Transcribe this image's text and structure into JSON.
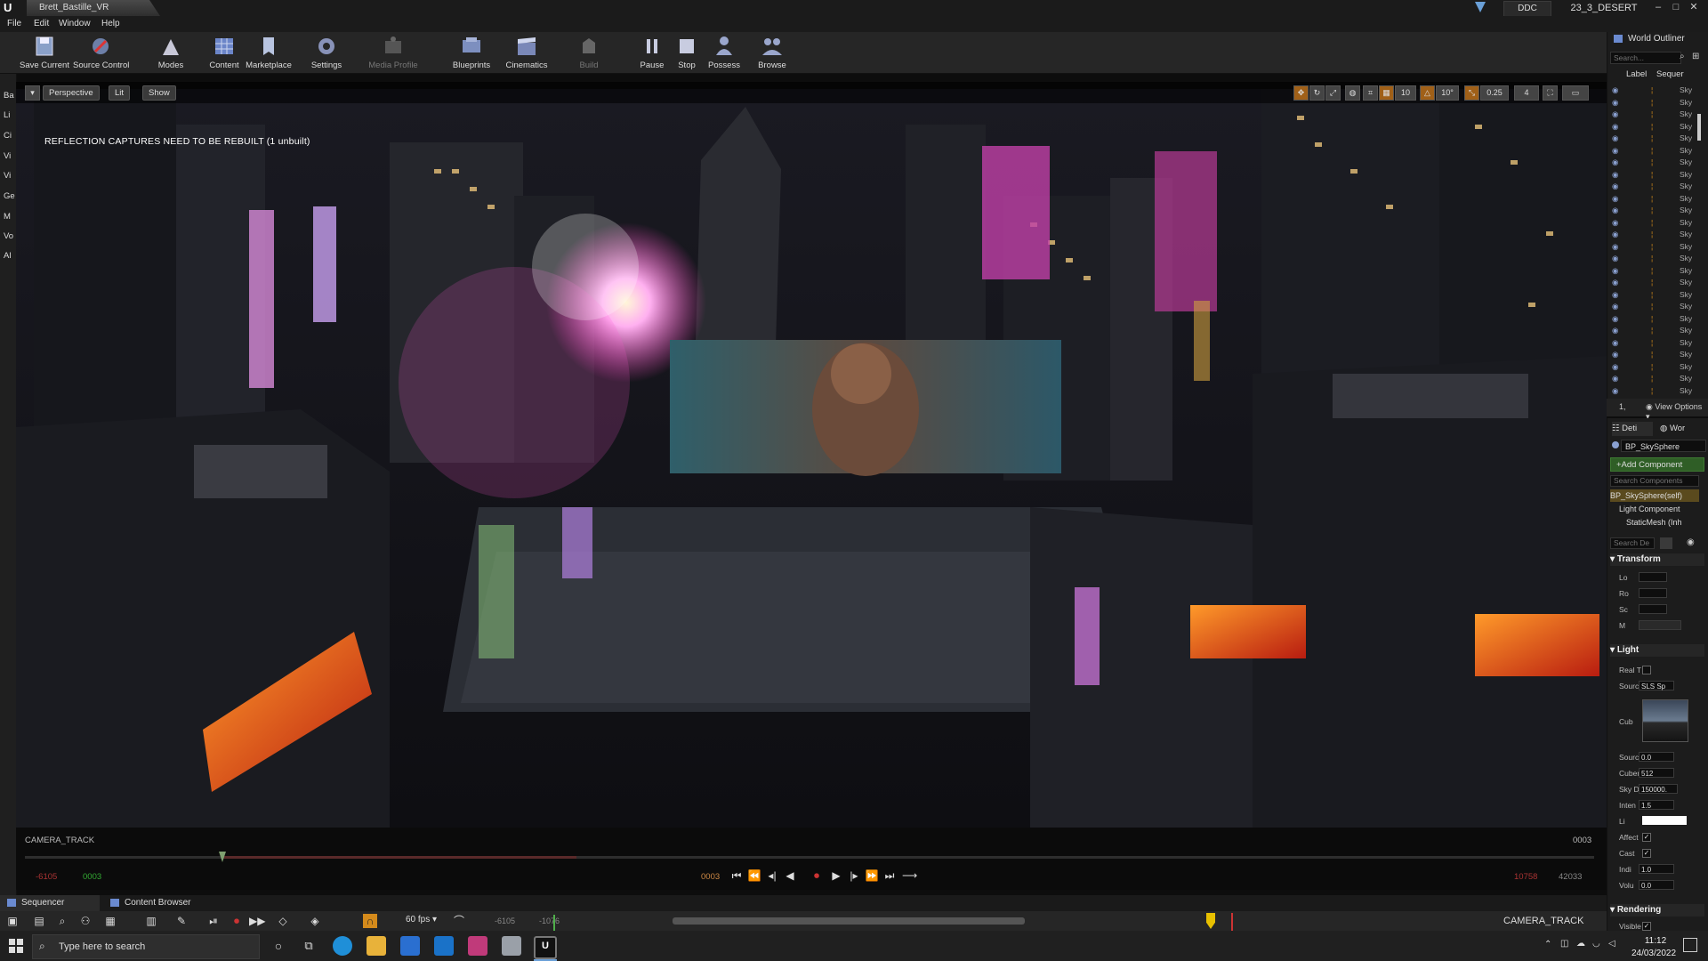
{
  "window": {
    "doc_tab": "Brett_Bastille_VR",
    "ddc_label": "DDC",
    "project_name": "23_3_DESERT"
  },
  "menu": [
    "File",
    "Edit",
    "Window",
    "Help"
  ],
  "toolbar": {
    "save_current": "Save Current",
    "source_control": "Source Control",
    "modes": "Modes",
    "content": "Content",
    "marketplace": "Marketplace",
    "settings": "Settings",
    "media_profile": "Media Profile",
    "blueprints": "Blueprints",
    "cinematics": "Cinematics",
    "build": "Build",
    "pause": "Pause",
    "stop": "Stop",
    "possess": "Possess",
    "browse": "Browse"
  },
  "left_strip": [
    "Ba",
    "Li",
    "Ci",
    "Vi",
    "Vi",
    "Ge",
    "M",
    "Vo",
    "Al"
  ],
  "viewport": {
    "perspective": "Perspective",
    "lit": "Lit",
    "show": "Show",
    "grid_snap": "10",
    "rot_snap": "10°",
    "scale_snap": "0.25",
    "camera_speed": "4",
    "warning": "REFLECTION CAPTURES NEED TO BE REBUILT (1 unbuilt)"
  },
  "transport": {
    "track_label": "CAMERA_TRACK",
    "frame_right": "0003",
    "range_start_out": "-6105",
    "range_start_in": "0003",
    "current_frame": "0003",
    "range_end_in": "10758",
    "range_end_out": "42033",
    "progress_fraction": 0.36
  },
  "bottom_tabs": {
    "sequencer": "Sequencer",
    "content_browser": "Content Browser"
  },
  "sequencer": {
    "fps": "60 fps",
    "start_out": "-6105",
    "start_in": "-1076",
    "track_name": "CAMERA_TRACK"
  },
  "taskbar": {
    "search_placeholder": "Type here to search",
    "time": "11:12",
    "date": "24/03/2022"
  },
  "outliner": {
    "title": "World Outliner",
    "search_placeholder": "Search...",
    "col_label": "Label",
    "col_sequence": "Sequer",
    "rows": [
      "Sky",
      "Sky",
      "Sky",
      "Sky",
      "Sky",
      "Sky",
      "Sky",
      "Sky",
      "Sky",
      "Sky",
      "Sky",
      "Sky",
      "Sky",
      "Sky",
      "Sky",
      "Sky",
      "Sky",
      "Sky",
      "Sky",
      "Sky",
      "Sky",
      "Sky",
      "Sky",
      "Sky",
      "Sky",
      "Sky",
      "Sky"
    ],
    "count": "1,",
    "view_options": "View Options"
  },
  "details": {
    "tab_details": "Deti",
    "tab_world": "Wor",
    "actor_name": "BP_SkySphere",
    "add_component": "+Add Component",
    "search_components": "Search Components",
    "components": [
      "BP_SkySphere(self)",
      "Light Component",
      "StaticMesh (Inh"
    ],
    "search_details": "Search De",
    "sections": {
      "transform": "Transform",
      "light": "Light",
      "rendering": "Rendering"
    },
    "transform_props": [
      "Lo",
      "Ro",
      "Sc",
      "M"
    ],
    "light_props": {
      "real_time": "Real T",
      "source_type": "Source",
      "source_value": "SLS Sp",
      "cubemap": "Cub",
      "source_angle": "Sourc",
      "source_angle_value": "0.0",
      "cubemap_res": "Cubem",
      "cubemap_res_value": "512",
      "sky_distance": "Sky Di",
      "sky_distance_value": "150000.",
      "intensity": "Inten",
      "intensity_value": "1.5",
      "light_color": "Li",
      "affects": "Affect",
      "cast": "Cast",
      "indirect": "Indi",
      "indirect_value": "1.0",
      "volumetric": "Volu",
      "volumetric_value": "0.0"
    },
    "rendering_props": {
      "visible": "Visible"
    }
  },
  "colors": {
    "accent_orange": "#d48a1b",
    "add_component_green": "#2f5e26",
    "record_red": "#cc3333"
  }
}
